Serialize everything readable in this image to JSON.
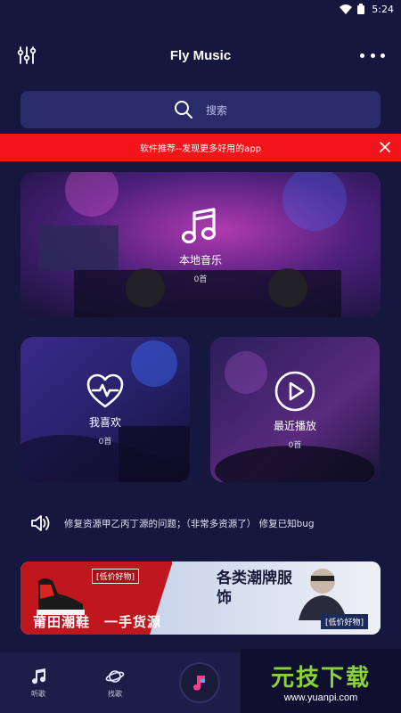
{
  "status_bar": {
    "time": "5:24"
  },
  "header": {
    "title": "Fly Music"
  },
  "search": {
    "placeholder": "搜索"
  },
  "banner": {
    "text": "软件推荐--发现更多好用的app"
  },
  "cards": {
    "local": {
      "label": "本地音乐",
      "count": "0首"
    },
    "favorite": {
      "label": "我喜欢",
      "count": "0首"
    },
    "recent": {
      "label": "最近播放",
      "count": "0首"
    }
  },
  "notice": {
    "text": "修复资源甲乙丙丁源的问题；（非常多资源了） 修复已知bug"
  },
  "ad": {
    "tag": "[低价好物]",
    "headline_left": "莆田潮鞋　一手货源",
    "headline_right": "各类潮牌服饰",
    "tag_right": "[低价好物]"
  },
  "bottom_nav": {
    "items": [
      {
        "label": "听歌",
        "icon": "music-note-icon"
      },
      {
        "label": "找歌",
        "icon": "planet-icon"
      }
    ]
  },
  "watermark": {
    "title": "元技下载",
    "url": "www.yuanpi.com"
  },
  "colors": {
    "background": "#16173f",
    "search_bg": "#2a2b69",
    "banner_red": "#f3141c",
    "nav_bg": "#1c1d48"
  }
}
